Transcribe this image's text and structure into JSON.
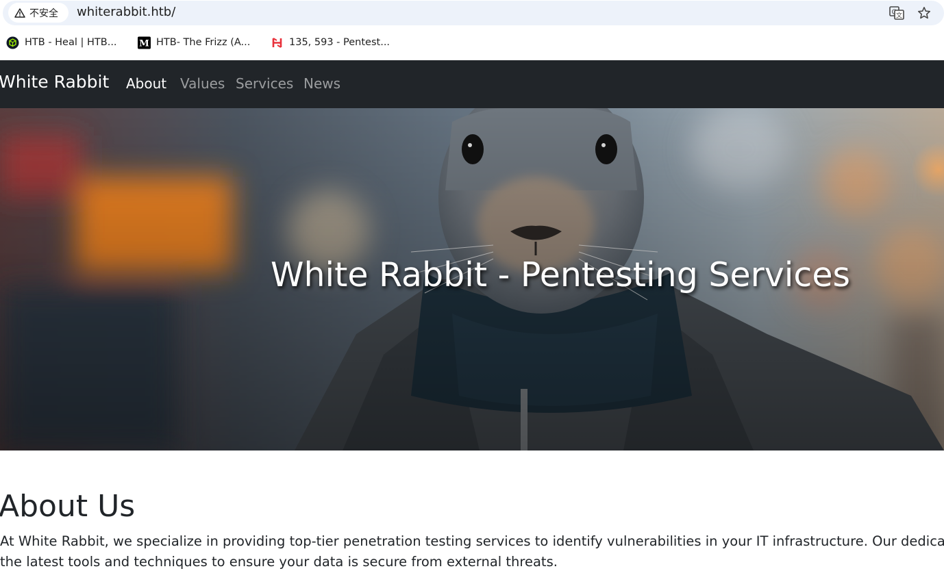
{
  "browser": {
    "security_label": "不安全",
    "url": "whiterabbit.htb/",
    "bookmarks": [
      {
        "label": "HTB - Heal | HTB...",
        "icon": "htb-favicon-icon"
      },
      {
        "label": "HTB- The Frizz (A...",
        "icon": "medium-favicon-icon"
      },
      {
        "label": "135, 593 - Pentest...",
        "icon": "hacktricks-favicon-icon"
      }
    ],
    "icons": [
      "warning-icon",
      "translate-icon",
      "star-icon"
    ]
  },
  "navbar": {
    "brand": "White Rabbit",
    "links": [
      "About",
      "Values",
      "Services",
      "News"
    ],
    "active_link": "About",
    "colors": {
      "background": "#212529",
      "active": "#ffffff",
      "inactive": "rgba(255,255,255,0.55)"
    }
  },
  "hero": {
    "title": "White Rabbit - Pentesting Services"
  },
  "about": {
    "heading": "About Us",
    "line1": "At White Rabbit, we specialize in providing top-tier penetration testing services to identify vulnerabilities in your IT infrastructure. Our dedicated",
    "line2": "the latest tools and techniques to ensure your data is secure from external threats."
  }
}
